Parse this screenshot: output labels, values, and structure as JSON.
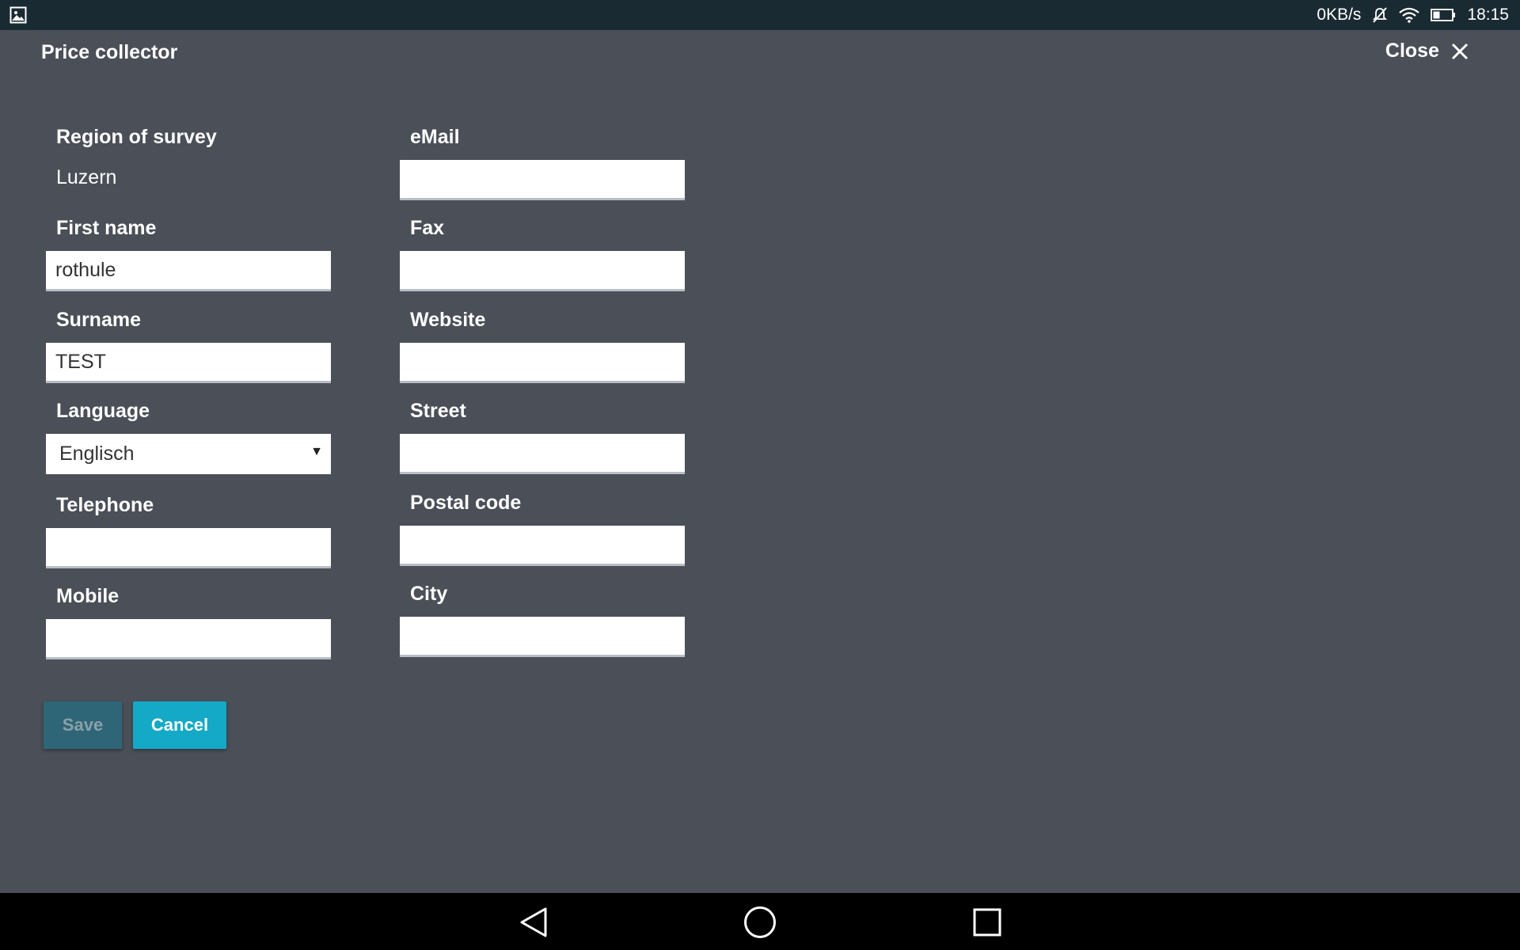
{
  "status_bar": {
    "gallery_icon": "image-icon",
    "network_speed": "0KB/s",
    "mute_icon": "mute-icon",
    "wifi_icon": "wifi-icon",
    "battery_icon": "battery-icon",
    "time": "18:15"
  },
  "header": {
    "title": "Price collector",
    "close_label": "Close",
    "close_icon": "close-icon"
  },
  "form": {
    "region": {
      "label": "Region of survey",
      "value": "Luzern"
    },
    "first_name": {
      "label": "First name",
      "value": "rothule",
      "placeholder": ""
    },
    "surname": {
      "label": "Surname",
      "value": "TEST",
      "placeholder": ""
    },
    "language": {
      "label": "Language",
      "selected": "Englisch"
    },
    "telephone": {
      "label": "Telephone",
      "value": "",
      "placeholder": ""
    },
    "mobile": {
      "label": "Mobile",
      "value": "",
      "placeholder": ""
    },
    "email": {
      "label": "eMail",
      "value": "",
      "placeholder": ""
    },
    "fax": {
      "label": "Fax",
      "value": "",
      "placeholder": ""
    },
    "website": {
      "label": "Website",
      "value": "",
      "placeholder": ""
    },
    "street": {
      "label": "Street",
      "value": "",
      "placeholder": ""
    },
    "postal_code": {
      "label": "Postal code",
      "value": "",
      "placeholder": ""
    },
    "city": {
      "label": "City",
      "value": "",
      "placeholder": ""
    }
  },
  "actions": {
    "save_label": "Save",
    "cancel_label": "Cancel"
  },
  "nav_bar": {
    "back_icon": "back-triangle-icon",
    "home_icon": "home-circle-icon",
    "recents_icon": "recents-square-icon"
  },
  "colors": {
    "background": "#4a4f58",
    "status_bar": "#1a2a33",
    "save_disabled": "#2f6677",
    "cancel_accent": "#14a9c6"
  }
}
